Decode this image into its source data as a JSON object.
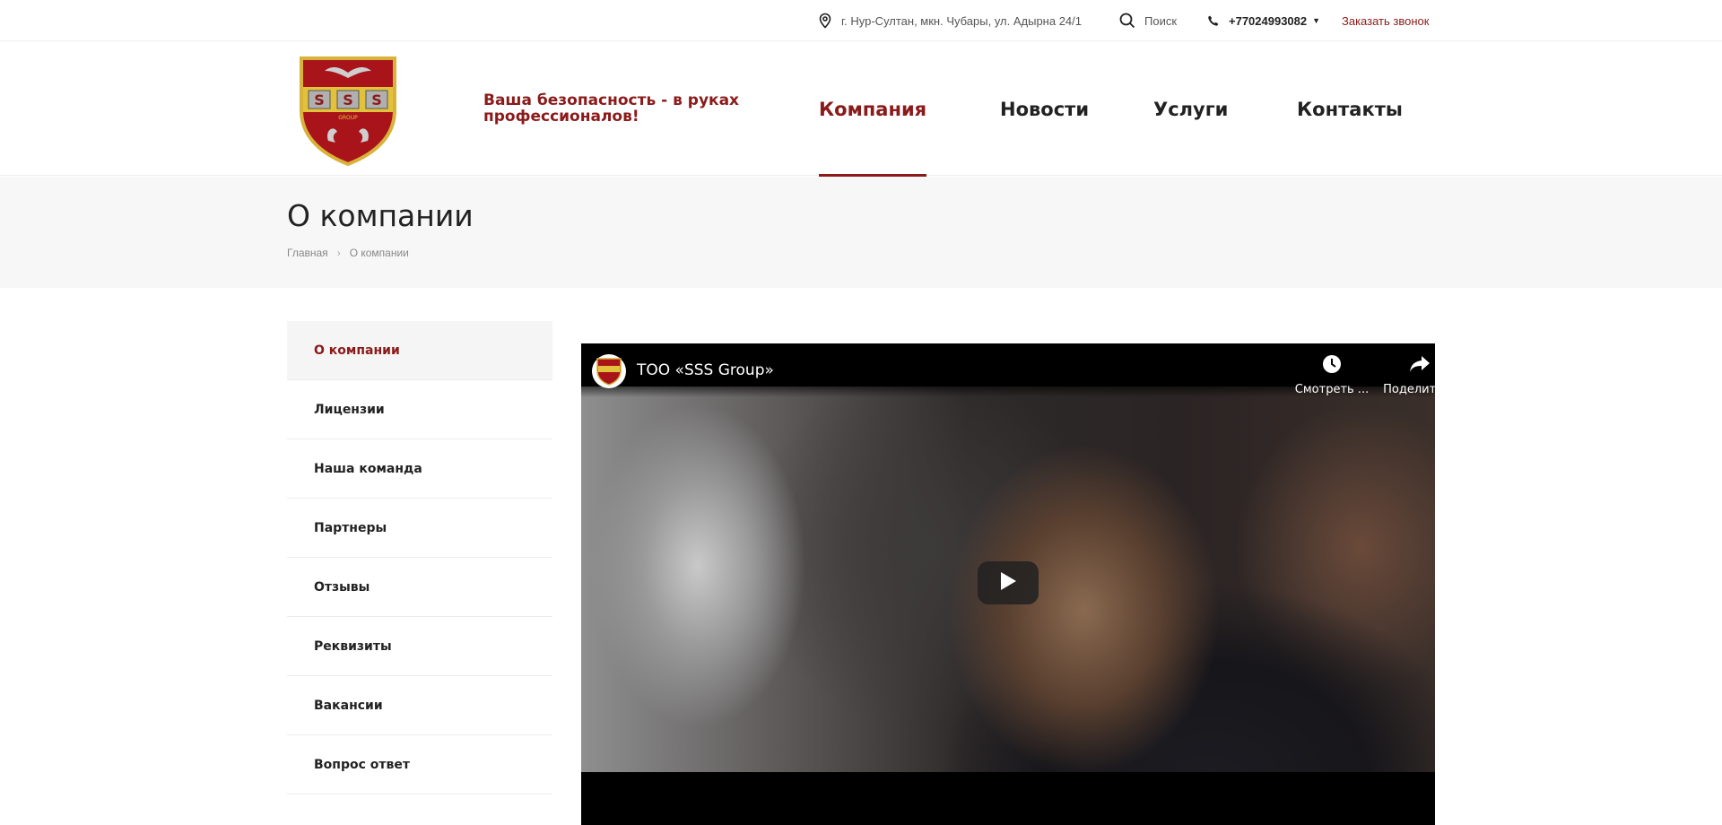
{
  "topbar": {
    "address": "г. Нур-Султан, мкн. Чубары, ул. Адырна 24/1",
    "search_label": "Поиск",
    "phone": "+77024993082",
    "callback_label": "Заказать звонок"
  },
  "header": {
    "logo_text": "SSS",
    "logo_subtext": "GROUP",
    "slogan": "Ваша безопасность - в руках профессионалов!",
    "nav": [
      {
        "label": "Компания",
        "active": true
      },
      {
        "label": "Новости",
        "active": false
      },
      {
        "label": "Услуги",
        "active": false
      },
      {
        "label": "Контакты",
        "active": false
      }
    ]
  },
  "page": {
    "title": "О компании",
    "breadcrumb": [
      "Главная",
      "О компании"
    ]
  },
  "sidebar": {
    "items": [
      {
        "label": "О компании",
        "active": true
      },
      {
        "label": "Лицензии",
        "active": false
      },
      {
        "label": "Наша команда",
        "active": false
      },
      {
        "label": "Партнеры",
        "active": false
      },
      {
        "label": "Отзывы",
        "active": false
      },
      {
        "label": "Реквизиты",
        "active": false
      },
      {
        "label": "Вакансии",
        "active": false
      },
      {
        "label": "Вопрос ответ",
        "active": false
      }
    ]
  },
  "video": {
    "title": "ТОО «SSS Group»",
    "watch_later_label": "Смотреть ...",
    "share_label": "Поделиться"
  },
  "colors": {
    "accent": "#8b1a1a",
    "logo_red": "#a8141a",
    "logo_gold": "#e2c23a"
  }
}
